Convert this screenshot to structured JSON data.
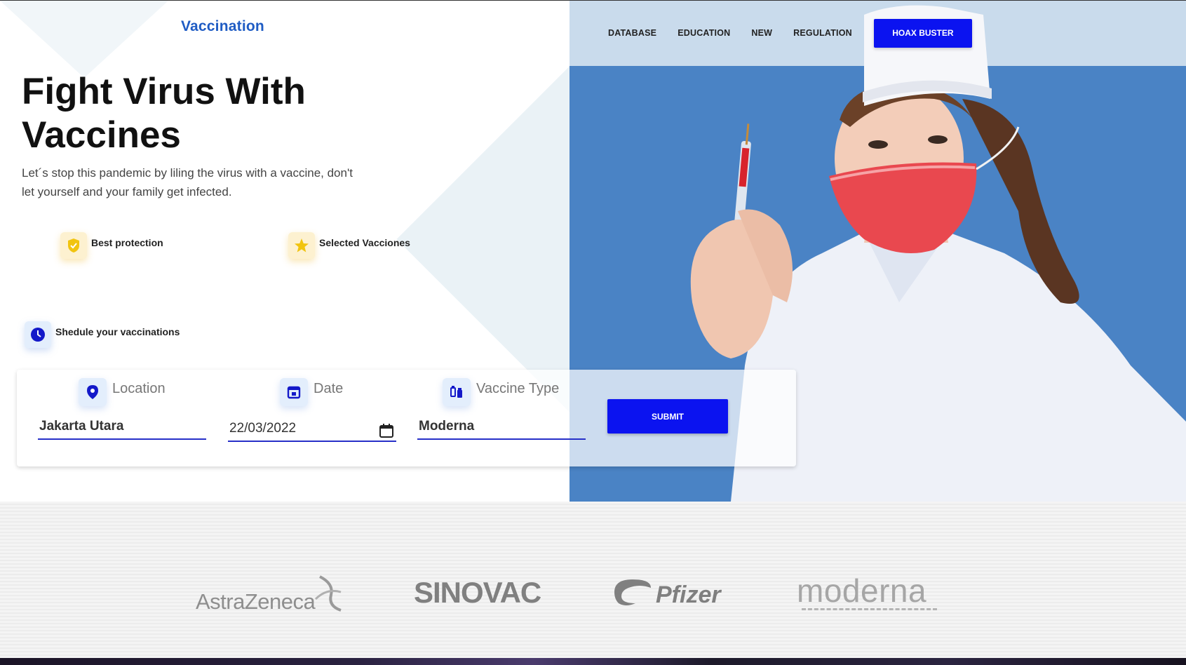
{
  "brand": {
    "logo": "Vaccination"
  },
  "nav": {
    "links": [
      "DATABASE",
      "EDUCATION",
      "NEW",
      "REGULATION"
    ],
    "cta": "HOAX BUSTER"
  },
  "hero": {
    "title": "Fight Virus With Vaccines",
    "subtitle": "Let´s stop this pandemic by liling the virus with a vaccine, don't let yourself and your family get infected."
  },
  "features": [
    {
      "label": "Best protection",
      "icon": "shield-check-icon"
    },
    {
      "label": "Selected Vacciones",
      "icon": "star-icon"
    },
    {
      "label": "Shedule your vaccinations",
      "icon": "clock-icon"
    }
  ],
  "form": {
    "location": {
      "label": "Location",
      "value": "Jakarta Utara",
      "icon": "location-pin-icon"
    },
    "date": {
      "label": "Date",
      "value": "22/03/2022",
      "icon": "calendar-icon"
    },
    "vaccine": {
      "label": "Vaccine Type",
      "value": "Moderna",
      "icon": "vaccine-icon"
    },
    "submit": "SUBMIT"
  },
  "partners": [
    "AstraZeneca",
    "SINOVAC",
    "Pfizer",
    "moderna"
  ],
  "colors": {
    "accent": "#0b13f0",
    "logo": "#1f5cc4",
    "hero_bg": "#4a83c5",
    "hero_band": "#c9dbec"
  }
}
